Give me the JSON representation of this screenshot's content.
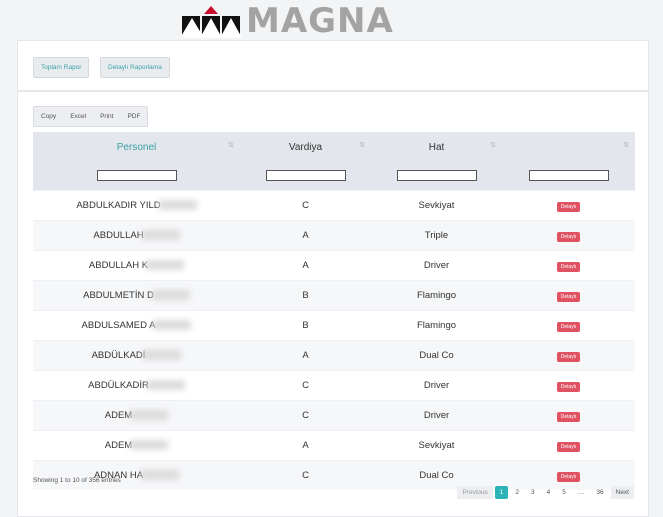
{
  "logo": {
    "text": "MAGNA"
  },
  "report_buttons": {
    "summary": "Toplam Rapor",
    "detailed": "Detaylı Raporlama"
  },
  "export_buttons": [
    "Copy",
    "Excel",
    "Print",
    "PDF"
  ],
  "table": {
    "columns": [
      "Personel",
      "Vardiya",
      "Hat",
      ""
    ],
    "rows": [
      {
        "personel": "ABDULKADIR YILD",
        "vardiya": "C",
        "hat": "Sevkiyat",
        "action": "Detaylı"
      },
      {
        "personel": "ABDULLAH",
        "vardiya": "A",
        "hat": "Triple",
        "action": "Detaylı"
      },
      {
        "personel": "ABDULLAH K",
        "vardiya": "A",
        "hat": "Driver",
        "action": "Detaylı"
      },
      {
        "personel": "ABDULMETİN D",
        "vardiya": "B",
        "hat": "Flamingo",
        "action": "Detaylı"
      },
      {
        "personel": "ABDULSAMED A",
        "vardiya": "B",
        "hat": "Flamingo",
        "action": "Detaylı"
      },
      {
        "personel": "ABDÜLKADİ",
        "vardiya": "A",
        "hat": "Dual Co",
        "action": "Detaylı"
      },
      {
        "personel": "ABDÜLKADİR",
        "vardiya": "C",
        "hat": "Driver",
        "action": "Detaylı"
      },
      {
        "personel": "ADEM",
        "vardiya": "C",
        "hat": "Driver",
        "action": "Detaylı"
      },
      {
        "personel": "ADEM",
        "vardiya": "A",
        "hat": "Sevkiyat",
        "action": "Detaylı"
      },
      {
        "personel": "ADNAN HA",
        "vardiya": "C",
        "hat": "Dual Co",
        "action": "Detaylı"
      }
    ]
  },
  "info": "Showing 1 to 10 of 356 entries",
  "pagination": {
    "previous": "Previous",
    "pages": [
      "1",
      "2",
      "3",
      "4",
      "5",
      "…",
      "36"
    ],
    "active": "1",
    "next": "Next"
  },
  "colors": {
    "accent": "#2bb3b8",
    "badge": "#e05262",
    "logo_red": "#c8102e",
    "logo_gray": "#a3a3a3"
  }
}
